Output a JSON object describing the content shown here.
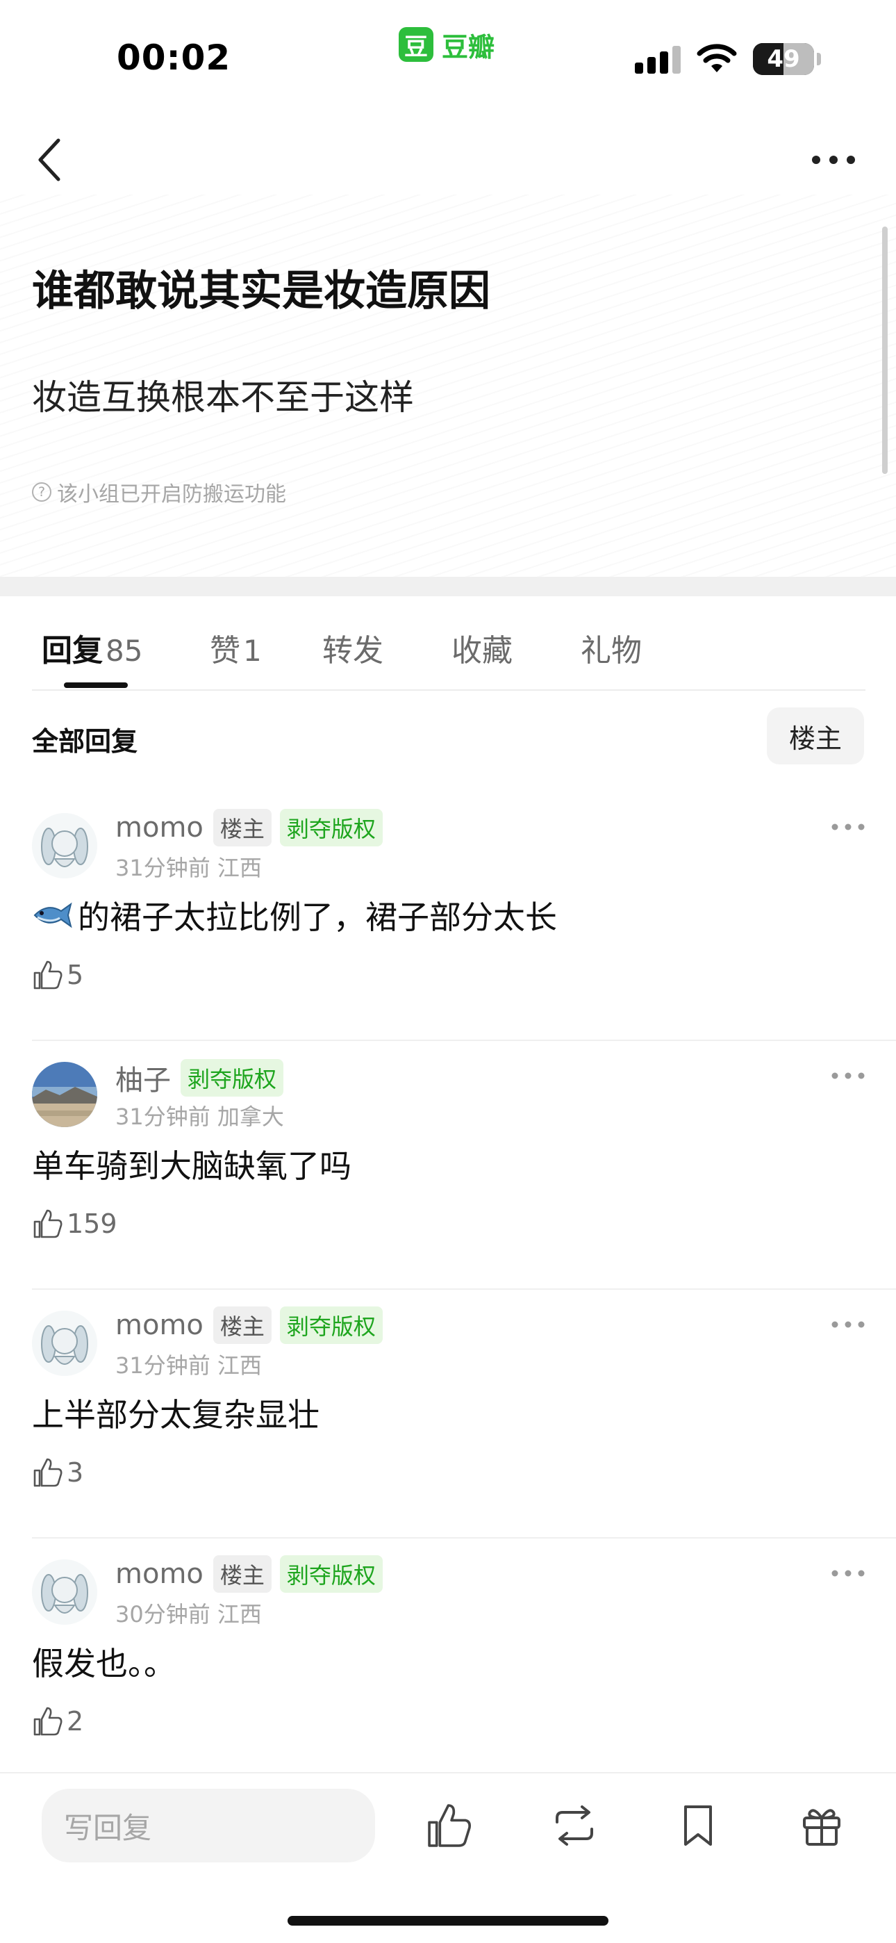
{
  "status_bar": {
    "time": "00:02",
    "app_logo": "豆",
    "app_name": "豆瓣",
    "battery": "49"
  },
  "post": {
    "title": "谁都敢说其实是妆造原因",
    "body": "妆造互换根本不至于这样",
    "notice": "该小组已开启防搬运功能",
    "notice_icon": "?"
  },
  "tabs": [
    {
      "label": "回复",
      "count": "85"
    },
    {
      "label": "赞",
      "count": "1"
    },
    {
      "label": "转发",
      "count": ""
    },
    {
      "label": "收藏",
      "count": ""
    },
    {
      "label": "礼物",
      "count": ""
    }
  ],
  "section": {
    "title": "全部回复",
    "filter_label": "楼主"
  },
  "comments": [
    {
      "user": "momo",
      "op_badge": "楼主",
      "copyright_badge": "剥夺版权",
      "meta": "31分钟前 江西",
      "fish": "🐟",
      "text": "的裙子太拉比例了，裙子部分太长",
      "likes": "5"
    },
    {
      "user": "柚子",
      "op_badge": "",
      "copyright_badge": "剥夺版权",
      "meta": "31分钟前 加拿大",
      "text": "单车骑到大脑缺氧了吗",
      "likes": "159"
    },
    {
      "user": "momo",
      "op_badge": "楼主",
      "copyright_badge": "剥夺版权",
      "meta": "31分钟前 江西",
      "text": "上半部分太复杂显壮",
      "likes": "3"
    },
    {
      "user": "momo",
      "op_badge": "楼主",
      "copyright_badge": "剥夺版权",
      "meta": "30分钟前 江西",
      "text": "假发也。。",
      "likes": "2"
    }
  ],
  "bottom_bar": {
    "reply_placeholder": "写回复"
  },
  "icons": {
    "back": "chevron-left-icon",
    "more": "more-dots-icon",
    "like": "thumbs-up-icon",
    "repost": "repost-icon",
    "bookmark": "bookmark-icon",
    "gift": "gift-icon"
  },
  "colors": {
    "brand_green": "#2dbe3c",
    "badge_green": "#1ea51e",
    "muted": "#a6a6a6"
  }
}
